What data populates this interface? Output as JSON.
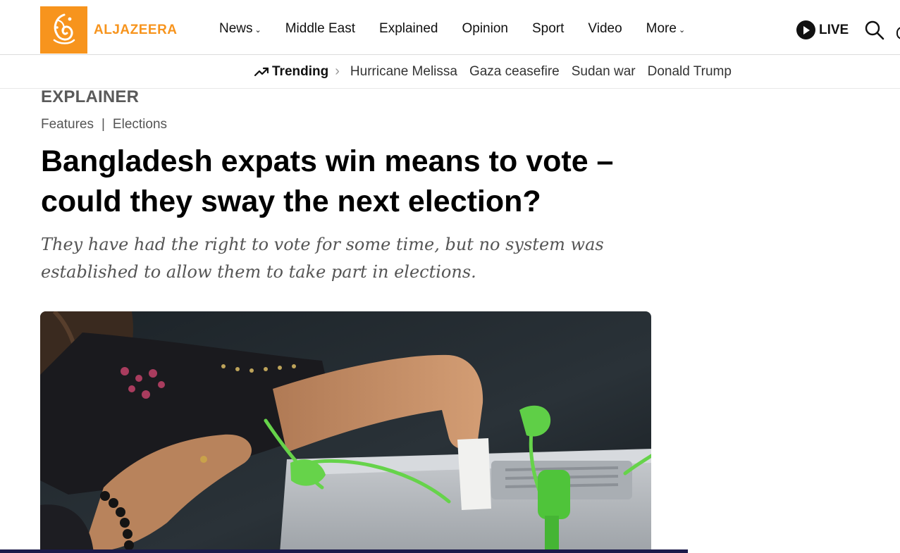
{
  "header": {
    "logo_text": "ALJAZEERA",
    "nav": [
      {
        "label": "News",
        "has_menu": true
      },
      {
        "label": "Middle East",
        "has_menu": false
      },
      {
        "label": "Explained",
        "has_menu": false
      },
      {
        "label": "Opinion",
        "has_menu": false
      },
      {
        "label": "Sport",
        "has_menu": false
      },
      {
        "label": "Video",
        "has_menu": false
      },
      {
        "label": "More",
        "has_menu": true
      }
    ],
    "live_label": "LIVE",
    "icons": {
      "play": "play-icon",
      "search": "search-icon",
      "chevron": "chevron-down-icon"
    }
  },
  "trending": {
    "label": "Trending",
    "icon": "trending-up-icon",
    "topics": [
      "Hurricane Melissa",
      "Gaza ceasefire",
      "Sudan war",
      "Donald Trump"
    ]
  },
  "article": {
    "kicker": "EXPLAINER",
    "breadcrumb": [
      "Features",
      "Elections"
    ],
    "breadcrumb_divider": "|",
    "headline": "Bangladesh expats win means to vote – could they sway the next election?",
    "dek": "They have had the right to vote for some time, but no system was established to allow them to take part in elections."
  },
  "colors": {
    "brand_orange": "#f7941d",
    "footer_bar": "#1b1a4a",
    "ballot_seal_green": "#66d34a"
  }
}
